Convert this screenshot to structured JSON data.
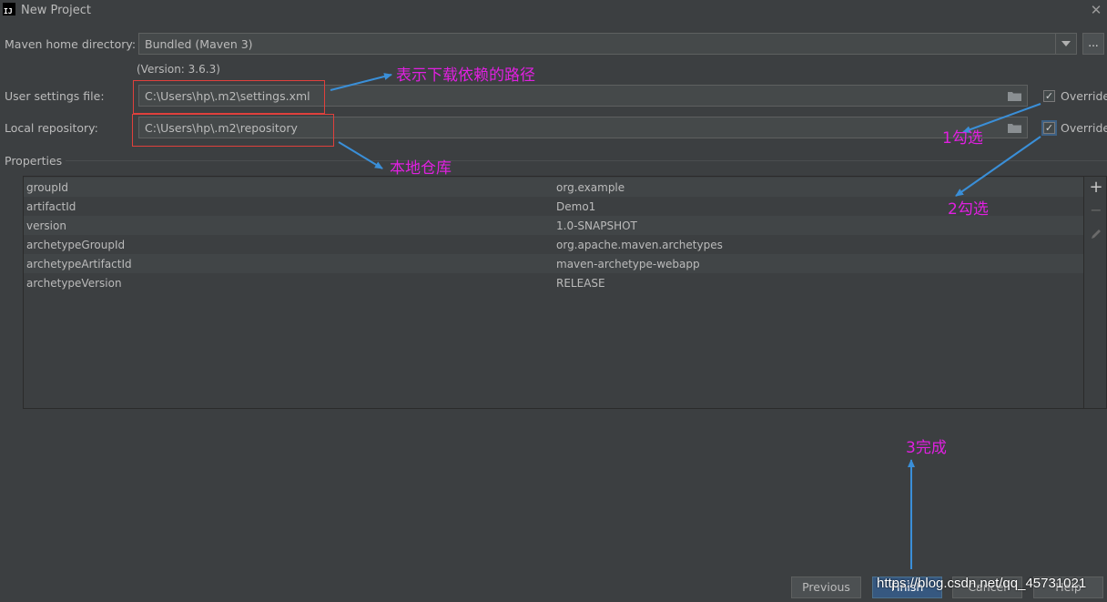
{
  "window": {
    "title": "New Project",
    "app_icon": "IJ"
  },
  "maven_home": {
    "label": "Maven home directory:",
    "value": "Bundled (Maven 3)",
    "browse_label": "...",
    "version_note": "(Version: 3.6.3)"
  },
  "user_settings": {
    "label": "User settings file:",
    "value": "C:\\Users\\hp\\.m2\\settings.xml",
    "override_label": "Override",
    "override_checked": true
  },
  "local_repo": {
    "label": "Local repository:",
    "value": "C:\\Users\\hp\\.m2\\repository",
    "override_label": "Override",
    "override_checked": true
  },
  "properties": {
    "header": "Properties",
    "rows": [
      {
        "key": "groupId",
        "value": "org.example"
      },
      {
        "key": "artifactId",
        "value": "Demo1"
      },
      {
        "key": "version",
        "value": "1.0-SNAPSHOT"
      },
      {
        "key": "archetypeGroupId",
        "value": "org.apache.maven.archetypes"
      },
      {
        "key": "archetypeArtifactId",
        "value": "maven-archetype-webapp"
      },
      {
        "key": "archetypeVersion",
        "value": "RELEASE"
      }
    ],
    "tools": [
      "plus-icon",
      "minus-icon",
      "pencil-icon"
    ]
  },
  "buttons": {
    "previous": "Previous",
    "finish": "Finish",
    "cancel": "Cancel",
    "help": "Help"
  },
  "annotations": {
    "settings_path": "表示下载依赖的路径",
    "local_repo": "本地仓库",
    "check1": "1勾选",
    "check2": "2勾选",
    "finish": "3完成"
  },
  "watermark": "https://blog.csdn.net/qq_45731021",
  "colors": {
    "annotation_text": "#e020e0",
    "arrow": "#3a8fd8",
    "highlight_box": "#e0403c",
    "primary_button": "#365880"
  }
}
